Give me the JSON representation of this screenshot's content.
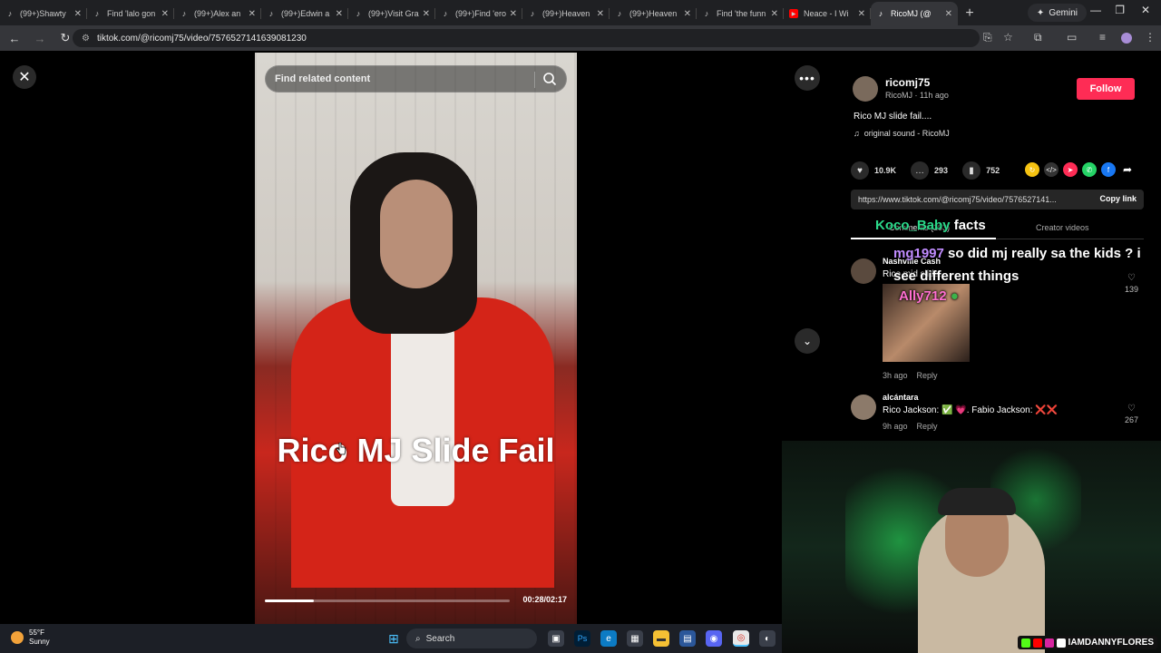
{
  "browser": {
    "tabs": [
      {
        "label": "(99+)Shawty",
        "icon": "tiktok-icon"
      },
      {
        "label": "Find 'lalo gon",
        "icon": "tiktok-icon"
      },
      {
        "label": "(99+)Alex an",
        "icon": "tiktok-icon"
      },
      {
        "label": "(99+)Edwin a",
        "icon": "tiktok-icon"
      },
      {
        "label": "(99+)Visit Gra",
        "icon": "tiktok-icon"
      },
      {
        "label": "(99+)Find 'ero",
        "icon": "tiktok-icon"
      },
      {
        "label": "(99+)Heaven",
        "icon": "tiktok-icon"
      },
      {
        "label": "(99+)Heaven",
        "icon": "tiktok-icon"
      },
      {
        "label": "Find 'the funn",
        "icon": "tiktok-icon"
      },
      {
        "label": "Neace - I Wi",
        "icon": "youtube-icon"
      },
      {
        "label": "RicoMJ (@",
        "icon": "tiktok-icon"
      }
    ],
    "gemini_label": "Gemini",
    "url": "tiktok.com/@ricomj75/video/7576527141639081230"
  },
  "video": {
    "search_placeholder": "Find related content",
    "caption": "Rico MJ Slide Fail",
    "timecode": "00:28/02:17",
    "progress": 0.2
  },
  "post": {
    "username": "ricomj75",
    "subline": "RicoMJ · 11h ago",
    "follow_label": "Follow",
    "description": "Rico MJ slide fail....",
    "sound": "original sound - RicoMJ",
    "likes": "10.9K",
    "comments": "293",
    "saves": "752",
    "link": "https://www.tiktok.com/@ricomj75/video/7576527141...",
    "copy_label": "Copy link",
    "tab_comments": "Comments (293)",
    "tab_creator": "Creator videos"
  },
  "comments": [
    {
      "name": "Nashville Cash",
      "text": "Rico mid slide:",
      "time": "3h ago",
      "reply": "Reply",
      "likes": "139"
    },
    {
      "name": "alcántara",
      "text": "Rico Jackson: ✅ 💗. Fabio Jackson: ❌❌",
      "time": "9h ago",
      "reply": "Reply",
      "likes": "267"
    }
  ],
  "chat": [
    {
      "user": "Koco_Baby",
      "msg": "facts",
      "color": "#2bd98a"
    },
    {
      "user": "mg1997",
      "msg": "so did mj really sa the kids ? i see different things",
      "color": "#c08cff"
    },
    {
      "user": "Ally712",
      "msg": "",
      "color": "#ff6fd0"
    }
  ],
  "webcam": {
    "handle": "IAMDANNYFLORES"
  },
  "taskbar": {
    "temp": "55°F",
    "condition": "Sunny",
    "search_label": "Search"
  }
}
